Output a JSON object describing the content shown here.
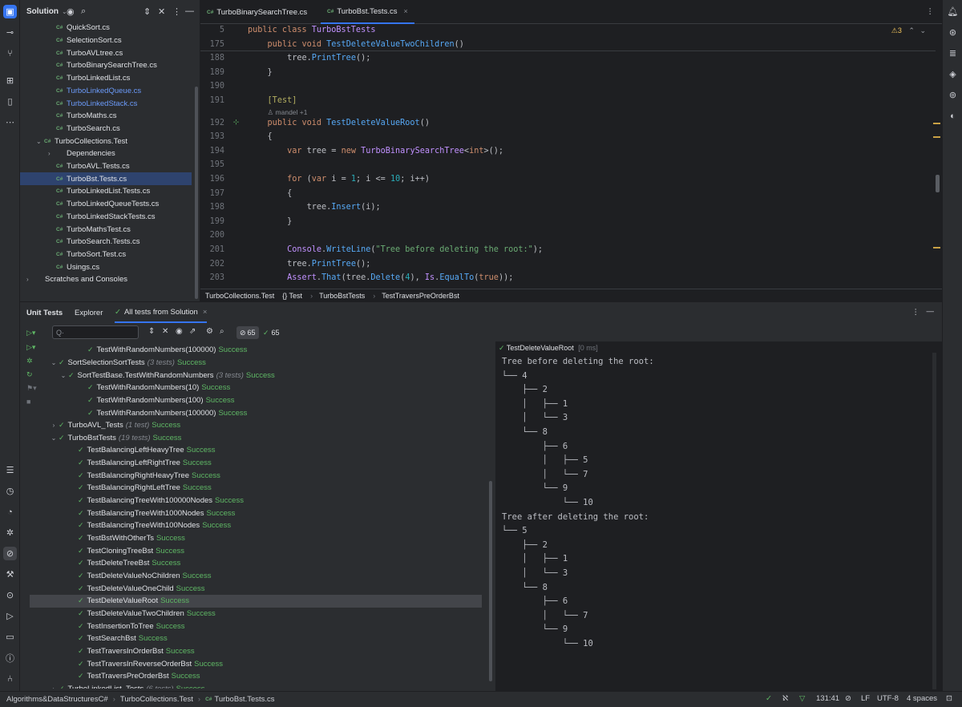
{
  "project": {
    "title": "Solution",
    "files": [
      {
        "name": "QuickSort.cs",
        "badge": "C#",
        "color": "normal",
        "indent": 1
      },
      {
        "name": "SelectionSort.cs",
        "badge": "C#",
        "color": "normal",
        "indent": 1
      },
      {
        "name": "TurboAVLtree.cs",
        "badge": "C#",
        "color": "normal",
        "indent": 1
      },
      {
        "name": "TurboBinarySearchTree.cs",
        "badge": "C#",
        "color": "normal",
        "indent": 1
      },
      {
        "name": "TurboLinkedList.cs",
        "badge": "C#",
        "color": "normal",
        "indent": 1
      },
      {
        "name": "TurboLinkedQueue.cs",
        "badge": "C#",
        "color": "blue",
        "indent": 1
      },
      {
        "name": "TurboLinkedStack.cs",
        "badge": "C#",
        "color": "blue",
        "indent": 1
      },
      {
        "name": "TurboMaths.cs",
        "badge": "C#",
        "color": "normal",
        "indent": 1
      },
      {
        "name": "TurboSearch.cs",
        "badge": "C#",
        "color": "normal",
        "indent": 1
      },
      {
        "name": "TurboCollections.Test",
        "badge": "C#",
        "color": "normal",
        "indent": 0,
        "chev": "⌄"
      },
      {
        "name": "Dependencies",
        "badge": "",
        "color": "normal",
        "indent": 1,
        "chev": "›"
      },
      {
        "name": "TurboAVL.Tests.cs",
        "badge": "C#",
        "color": "normal",
        "indent": 1
      },
      {
        "name": "TurboBst.Tests.cs",
        "badge": "C#",
        "color": "normal",
        "indent": 1,
        "selected": true
      },
      {
        "name": "TurboLinkedList.Tests.cs",
        "badge": "C#",
        "color": "normal",
        "indent": 1
      },
      {
        "name": "TurboLinkedQueueTests.cs",
        "badge": "C#",
        "color": "normal",
        "indent": 1
      },
      {
        "name": "TurboLinkedStackTests.cs",
        "badge": "C#",
        "color": "normal",
        "indent": 1
      },
      {
        "name": "TurboMathsTest.cs",
        "badge": "C#",
        "color": "normal",
        "indent": 1
      },
      {
        "name": "TurboSearch.Tests.cs",
        "badge": "C#",
        "color": "normal",
        "indent": 1
      },
      {
        "name": "TurboSort.Test.cs",
        "badge": "C#",
        "color": "normal",
        "indent": 1
      },
      {
        "name": "Usings.cs",
        "badge": "C#",
        "color": "normal",
        "indent": 1
      },
      {
        "name": "Scratches and Consoles",
        "badge": "",
        "color": "normal",
        "indent": -1,
        "chev": "›"
      }
    ]
  },
  "editor": {
    "tabs": [
      {
        "label": "TurboBinarySearchTree.cs",
        "badge": "C#"
      },
      {
        "label": "TurboBst.Tests.cs",
        "badge": "C#",
        "close": "×"
      }
    ],
    "sticky": [
      {
        "ln": "5",
        "html": "<span class='kw'>public class </span><span class='cls'>TurboBstTests</span>"
      },
      {
        "ln": "175",
        "html": "    <span class='kw'>public void </span><span class='fn'>TestDeleteValueTwoChildren</span><span class='plain'>()</span>"
      }
    ],
    "lines": [
      {
        "ln": "188",
        "html": "        <span class='plain'>tree.</span><span class='meth'>PrintTree</span><span class='plain'>();</span>"
      },
      {
        "ln": "189",
        "html": "    <span class='plain'>}</span>"
      },
      {
        "ln": "190",
        "html": ""
      },
      {
        "ln": "191",
        "html": "    <span class='attr'>[Test]</span>"
      },
      {
        "ln": "",
        "html": "    <span class='inlay'>♙ mandel +1</span>",
        "inlay": true
      },
      {
        "ln": "192",
        "html": "    <span class='kw'>public void </span><span class='fn'>TestDeleteValueRoot</span><span class='plain'>()</span>",
        "gutter": "⊹"
      },
      {
        "ln": "193",
        "html": "    <span class='plain'>{</span>"
      },
      {
        "ln": "194",
        "html": "        <span class='kw'>var </span><span class='plain'>tree = </span><span class='kw'>new </span><span class='cls'>TurboBinarySearchTree</span><span class='plain'>&lt;</span><span class='kw'>int</span><span class='plain'>&gt;();</span>"
      },
      {
        "ln": "195",
        "html": ""
      },
      {
        "ln": "196",
        "html": "        <span class='kw'>for </span><span class='plain'>(</span><span class='kw'>var </span><span class='plain'>i = </span><span class='num'>1</span><span class='plain'>; i &lt;= </span><span class='num'>10</span><span class='plain'>; i++)</span>"
      },
      {
        "ln": "197",
        "html": "        <span class='plain'>{</span>"
      },
      {
        "ln": "198",
        "html": "            <span class='plain'>tree.</span><span class='meth'>Insert</span><span class='plain'>(i);</span>"
      },
      {
        "ln": "199",
        "html": "        <span class='plain'>}</span>"
      },
      {
        "ln": "200",
        "html": ""
      },
      {
        "ln": "201",
        "html": "        <span class='cls'>Console</span><span class='plain'>.</span><span class='meth'>WriteLine</span><span class='plain'>(</span><span class='str'>\"Tree before deleting the root:\"</span><span class='plain'>);</span>"
      },
      {
        "ln": "202",
        "html": "        <span class='plain'>tree.</span><span class='meth'>PrintTree</span><span class='plain'>();</span>"
      },
      {
        "ln": "203",
        "html": "        <span class='cls'>Assert</span><span class='plain'>.</span><span class='meth'>That</span><span class='plain'>(tree.</span><span class='meth'>Delete</span><span class='plain'>(</span><span class='num'>4</span><span class='plain'>), </span><span class='cls'>Is</span><span class='plain'>.</span><span class='meth'>EqualTo</span><span class='plain'>(</span><span class='kw'>true</span><span class='plain'>));</span>"
      }
    ],
    "warnings": "⚠3",
    "breadcrumb": [
      "TurboCollections.Test",
      "{} Test",
      "TurboBstTests",
      "TestTraversPreOrderBst"
    ]
  },
  "tests": {
    "tabs": [
      "Unit Tests",
      "Explorer",
      "All tests from Solution"
    ],
    "search_placeholder": "Q·",
    "count_badge": "65",
    "pass_count": "65",
    "rows": [
      {
        "indent": 5,
        "name": "TestWithRandomNumbers(100000)",
        "meta": "",
        "status": "Success"
      },
      {
        "indent": 2,
        "chev": "⌄",
        "name": "SortSelectionSortTests",
        "meta": "(3 tests)",
        "status": "Success"
      },
      {
        "indent": 3,
        "chev": "⌄",
        "name": "SortTestBase.TestWithRandomNumbers",
        "meta": "(3 tests)",
        "status": "Success"
      },
      {
        "indent": 5,
        "name": "TestWithRandomNumbers(10)",
        "meta": "",
        "status": "Success"
      },
      {
        "indent": 5,
        "name": "TestWithRandomNumbers(100)",
        "meta": "",
        "status": "Success"
      },
      {
        "indent": 5,
        "name": "TestWithRandomNumbers(100000)",
        "meta": "",
        "status": "Success"
      },
      {
        "indent": 2,
        "chev": "›",
        "name": "TurboAVL_Tests",
        "meta": "(1 test)",
        "status": "Success"
      },
      {
        "indent": 2,
        "chev": "⌄",
        "name": "TurboBstTests",
        "meta": "(19 tests)",
        "status": "Success"
      },
      {
        "indent": 4,
        "name": "TestBalancingLeftHeavyTree",
        "meta": "",
        "status": "Success"
      },
      {
        "indent": 4,
        "name": "TestBalancingLeftRightTree",
        "meta": "",
        "status": "Success"
      },
      {
        "indent": 4,
        "name": "TestBalancingRightHeavyTree",
        "meta": "",
        "status": "Success"
      },
      {
        "indent": 4,
        "name": "TestBalancingRightLeftTree",
        "meta": "",
        "status": "Success"
      },
      {
        "indent": 4,
        "name": "TestBalancingTreeWith100000Nodes",
        "meta": "",
        "status": "Success"
      },
      {
        "indent": 4,
        "name": "TestBalancingTreeWith1000Nodes",
        "meta": "",
        "status": "Success"
      },
      {
        "indent": 4,
        "name": "TestBalancingTreeWith100Nodes",
        "meta": "",
        "status": "Success"
      },
      {
        "indent": 4,
        "name": "TestBstWithOtherTs",
        "meta": "",
        "status": "Success"
      },
      {
        "indent": 4,
        "name": "TestCloningTreeBst",
        "meta": "",
        "status": "Success"
      },
      {
        "indent": 4,
        "name": "TestDeleteTreeBst",
        "meta": "",
        "status": "Success"
      },
      {
        "indent": 4,
        "name": "TestDeleteValueNoChildren",
        "meta": "",
        "status": "Success"
      },
      {
        "indent": 4,
        "name": "TestDeleteValueOneChild",
        "meta": "",
        "status": "Success"
      },
      {
        "indent": 4,
        "name": "TestDeleteValueRoot",
        "meta": "",
        "status": "Success",
        "selected": true
      },
      {
        "indent": 4,
        "name": "TestDeleteValueTwoChildren",
        "meta": "",
        "status": "Success"
      },
      {
        "indent": 4,
        "name": "TestInsertionToTree",
        "meta": "",
        "status": "Success"
      },
      {
        "indent": 4,
        "name": "TestSearchBst",
        "meta": "",
        "status": "Success"
      },
      {
        "indent": 4,
        "name": "TestTraversInOrderBst",
        "meta": "",
        "status": "Success"
      },
      {
        "indent": 4,
        "name": "TestTraversInReverseOrderBst",
        "meta": "",
        "status": "Success"
      },
      {
        "indent": 4,
        "name": "TestTraversPreOrderBst",
        "meta": "",
        "status": "Success"
      },
      {
        "indent": 2,
        "chev": "›",
        "name": "TurboLinkedList_Tests",
        "meta": "(6 tests)",
        "status": "Success"
      }
    ]
  },
  "output": {
    "test_name": "TestDeleteValueRoot",
    "duration": "[0 ms]",
    "lines": [
      "Tree before deleting the root:",
      "└── 4",
      "    ├── 2",
      "    │   ├── 1",
      "    │   └── 3",
      "    └── 8",
      "        ├── 6",
      "        │   ├── 5",
      "        │   └── 7",
      "        └── 9",
      "            └── 10",
      "Tree after deleting the root:",
      "└── 5",
      "    ├── 2",
      "    │   ├── 1",
      "    │   └── 3",
      "    └── 8",
      "        ├── 6",
      "        │   └── 7",
      "        └── 9",
      "            └── 10"
    ]
  },
  "status_bar": {
    "crumbs": [
      "Algorithms&DataStructuresC#",
      "TurboCollections.Test",
      "TurboBst.Tests.cs"
    ],
    "position": "131:41",
    "line_ending": "LF",
    "encoding": "UTF-8",
    "indent": "4 spaces"
  }
}
